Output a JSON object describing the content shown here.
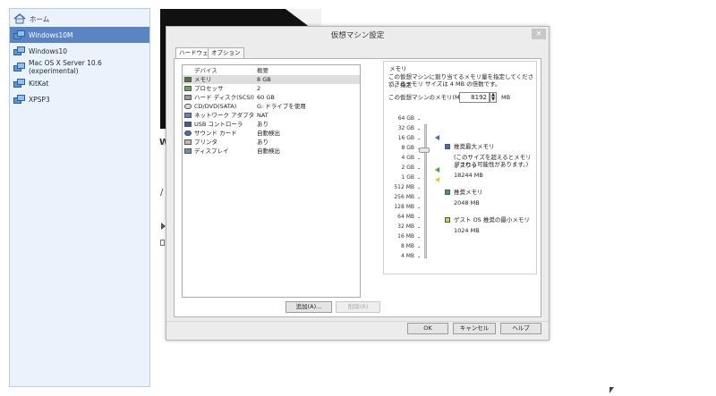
{
  "library": {
    "home": "ホーム",
    "items": [
      {
        "label": "Windows10M",
        "selected": true
      },
      {
        "label": "Windows10",
        "selected": false
      },
      {
        "label": "Mac OS X Server 10.6 (experimental)",
        "selected": false
      },
      {
        "label": "KitKat",
        "selected": false
      },
      {
        "label": "XPSP3",
        "selected": false
      }
    ]
  },
  "background": {
    "partial_letters": [
      "W",
      "/"
    ]
  },
  "dialog": {
    "title": "仮想マシン設定",
    "close_glyph": "×",
    "tabs": [
      "ハードウェア",
      "オプション"
    ],
    "device_list": {
      "header_device": "デバイス",
      "header_summary": "概要",
      "rows": [
        {
          "name": "メモリ",
          "summary": "8 GB",
          "icon": "memory-icon",
          "selected": true
        },
        {
          "name": "プロセッサ",
          "summary": "2",
          "icon": "processor-icon",
          "selected": false
        },
        {
          "name": "ハード ディスク(SCSI)",
          "summary": "60 GB",
          "icon": "hard-disk-icon",
          "selected": false
        },
        {
          "name": "CD/DVD(SATA)",
          "summary": "G: ドライブを使用",
          "icon": "cd-dvd-icon",
          "selected": false
        },
        {
          "name": "ネットワーク アダプタ",
          "summary": "NAT",
          "icon": "network-adapter-icon",
          "selected": false
        },
        {
          "name": "USB コントローラ",
          "summary": "あり",
          "icon": "usb-icon",
          "selected": false
        },
        {
          "name": "サウンド カード",
          "summary": "自動検出",
          "icon": "sound-card-icon",
          "selected": false
        },
        {
          "name": "プリンタ",
          "summary": "あり",
          "icon": "printer-icon",
          "selected": false
        },
        {
          "name": "ディスプレイ",
          "summary": "自動検出",
          "icon": "display-icon",
          "selected": false
        }
      ],
      "add_button": "追加(A)...",
      "remove_button": "削除(R)"
    },
    "memory": {
      "group_label": "メモリ",
      "description_line1": "この仮想マシンに割り当てるメモリ量を指定してください。指定",
      "description_line2": "できるメモリ サイズは 4 MB の倍数です。",
      "field_label": "この仮想マシンのメモリ(M):",
      "value": "8192",
      "unit": "MB",
      "scale_ticks": [
        "64 GB",
        "32 GB",
        "16 GB",
        "8 GB",
        "4 GB",
        "2 GB",
        "1 GB",
        "512 MB",
        "256 MB",
        "128 MB",
        "64 MB",
        "32 MB",
        "16 MB",
        "8 MB",
        "4 MB"
      ],
      "legend": {
        "max_label": "推奨最大メモリ",
        "max_note_line1": "(このサイズを超えるとメモリがスワッ",
        "max_note_line2": "プされる可能性があります。)",
        "max_value": "18244 MB",
        "rec_label": "推奨メモリ",
        "rec_value": "2048 MB",
        "min_label": "ゲスト OS 推奨の最小メモリ",
        "min_value": "1024 MB"
      },
      "colors": {
        "max": "#3f6fc6",
        "rec": "#3aa83a",
        "min": "#d9d02a"
      }
    },
    "footer": {
      "ok": "OK",
      "cancel": "キャンセル",
      "help": "ヘルプ"
    }
  }
}
